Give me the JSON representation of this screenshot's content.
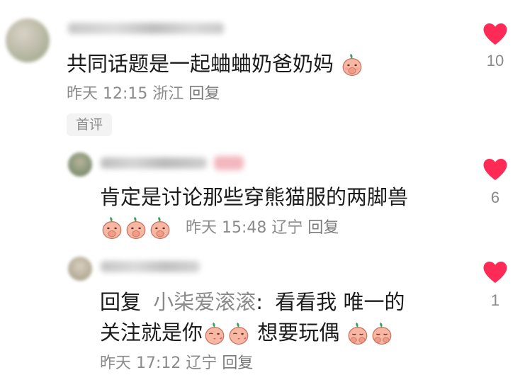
{
  "comments": [
    {
      "text": "共同话题是一起蛐蛐奶爸奶妈",
      "time": "昨天 12:15",
      "location": "浙江",
      "reply_label": "回复",
      "tag": "首评",
      "likes": "10",
      "emoji": [
        "cover-mouth-peach-emoji"
      ]
    },
    {
      "text": "肯定是讨论那些穿熊猫服的两脚兽",
      "time": "昨天 15:48",
      "location": "辽宁",
      "reply_label": "回复",
      "likes": "6",
      "emoji": [
        "cover-mouth-peach-emoji",
        "cover-mouth-peach-emoji",
        "cover-mouth-peach-emoji"
      ]
    },
    {
      "reply_prefix": "回复",
      "mention": "小柒爱滚滚",
      "colon": ":",
      "text_line1": "看看我 唯一的",
      "text_line2a": "关注就是你",
      "text_line2b": "想要玩偶",
      "time": "昨天 17:12",
      "location": "辽宁",
      "reply_label": "回复",
      "likes": "1",
      "emoji": [
        "kiss-peach-emoji",
        "kiss-peach-emoji",
        "shy-peach-emoji",
        "shy-peach-emoji"
      ]
    }
  ],
  "colors": {
    "heart": "#ff2a55",
    "peach": "#f7b7a3",
    "leaf": "#3a9d5d",
    "meta": "#8a8a8a",
    "text": "#1b1b1b"
  }
}
